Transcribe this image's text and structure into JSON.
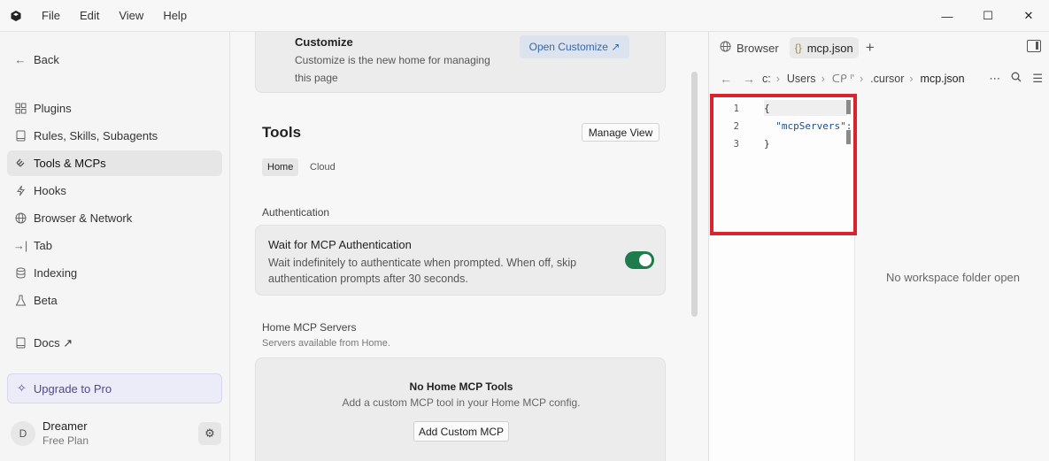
{
  "menu": [
    "File",
    "Edit",
    "View",
    "Help"
  ],
  "window_controls": {
    "minimize": "—",
    "maximize": "☐",
    "close": "✕"
  },
  "sidebar": {
    "back": "Back",
    "items": [
      {
        "label": "Plugins",
        "icon": "plugin-icon"
      },
      {
        "label": "Rules, Skills, Subagents",
        "icon": "book-icon"
      },
      {
        "label": "Tools & MCPs",
        "icon": "tools-icon",
        "active": true
      },
      {
        "label": "Hooks",
        "icon": "bolt-icon"
      },
      {
        "label": "Browser & Network",
        "icon": "globe-icon"
      },
      {
        "label": "Tab",
        "icon": "tab-arrow-icon"
      },
      {
        "label": "Indexing",
        "icon": "database-icon"
      },
      {
        "label": "Beta",
        "icon": "flask-icon"
      }
    ],
    "docs": "Docs ↗",
    "upgrade": "Upgrade to Pro",
    "user": {
      "initial": "D",
      "name": "Dreamer",
      "plan": "Free Plan"
    }
  },
  "main": {
    "customize": {
      "title": "Customize",
      "description": "Customize is the new home for managing this page",
      "button": "Open Customize ↗"
    },
    "tools_title": "Tools",
    "manage_view": "Manage View",
    "tabs": [
      "Home",
      "Cloud"
    ],
    "auth_section": "Authentication",
    "auth_card": {
      "title": "Wait for MCP Authentication",
      "description": "Wait indefinitely to authenticate when prompted. When off, skip authentication prompts after 30 seconds.",
      "toggle_on": true
    },
    "home_servers": {
      "title": "Home MCP Servers",
      "subtitle": "Servers available from Home.",
      "empty_title": "No Home MCP Tools",
      "empty_desc": "Add a custom MCP tool in your Home MCP config.",
      "button": "Add Custom MCP"
    }
  },
  "right_pane": {
    "tabs": [
      {
        "label": "Browser",
        "icon": "globe-icon"
      },
      {
        "label": "mcp.json",
        "icon": "braces-icon",
        "active": true
      }
    ],
    "breadcrumb": [
      "c:",
      "Users",
      "ᑕᑭ ᑊ'",
      ".cursor",
      "mcp.json"
    ],
    "editor": {
      "lines": [
        {
          "num": "1",
          "text": "{"
        },
        {
          "num": "2",
          "text": "  \"mcpServers\":"
        },
        {
          "num": "3",
          "text": "}"
        }
      ]
    },
    "empty_workspace": "No workspace folder open"
  }
}
